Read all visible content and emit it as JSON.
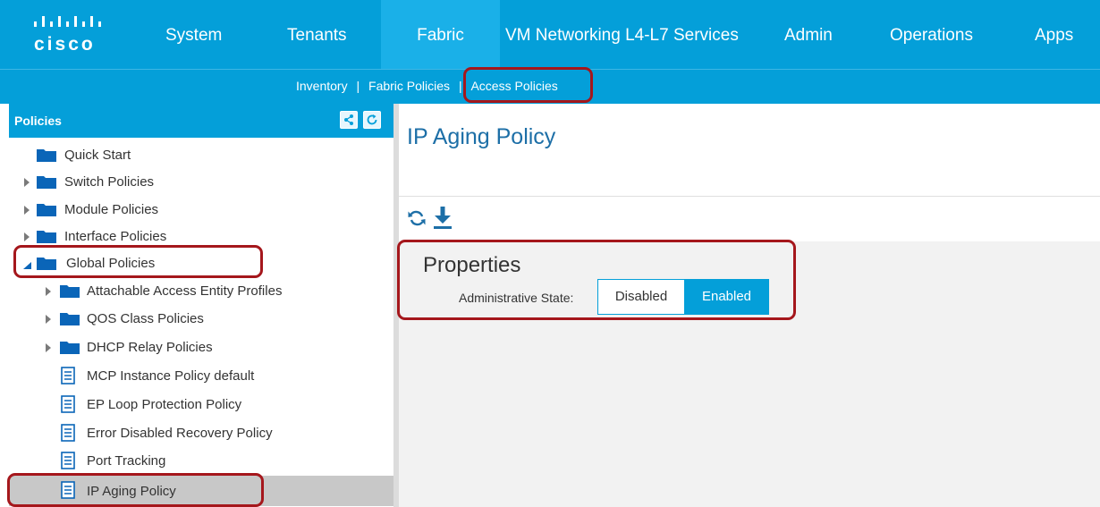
{
  "brand": {
    "logo_text": "cisco"
  },
  "topnav": {
    "items": [
      {
        "label": "System"
      },
      {
        "label": "Tenants"
      },
      {
        "label": "Fabric"
      },
      {
        "label": "VM Networking L4-L7 Services"
      },
      {
        "label": "Admin"
      },
      {
        "label": "Operations"
      },
      {
        "label": "Apps"
      }
    ],
    "active": "Fabric"
  },
  "subnav": {
    "items": [
      {
        "label": "Inventory"
      },
      {
        "label": "Fabric Policies"
      },
      {
        "label": "Access Policies"
      }
    ],
    "separator": "|",
    "active": "Access Policies"
  },
  "sidebar": {
    "title": "Policies",
    "header_icons": [
      "share-icon",
      "refresh-icon"
    ],
    "items": [
      {
        "label": "Quick Start",
        "icon": "folder-icon",
        "expandable": false
      },
      {
        "label": "Switch Policies",
        "icon": "folder-icon",
        "expandable": true,
        "expanded": false
      },
      {
        "label": "Module Policies",
        "icon": "folder-icon",
        "expandable": true,
        "expanded": false
      },
      {
        "label": "Interface Policies",
        "icon": "folder-icon",
        "expandable": true,
        "expanded": false
      },
      {
        "label": "Global Policies",
        "icon": "folder-icon",
        "expandable": true,
        "expanded": true
      },
      {
        "label": "Attachable Access Entity Profiles",
        "icon": "folder-icon",
        "expandable": true,
        "expanded": false
      },
      {
        "label": "QOS Class Policies",
        "icon": "folder-icon",
        "expandable": true,
        "expanded": false
      },
      {
        "label": "DHCP Relay Policies",
        "icon": "folder-icon",
        "expandable": true,
        "expanded": false
      },
      {
        "label": "MCP Instance Policy default",
        "icon": "policy-doc-icon",
        "expandable": false
      },
      {
        "label": "EP Loop Protection Policy",
        "icon": "policy-doc-icon",
        "expandable": false
      },
      {
        "label": "Error Disabled Recovery Policy",
        "icon": "policy-doc-icon",
        "expandable": false
      },
      {
        "label": "Port Tracking",
        "icon": "policy-doc-icon",
        "expandable": false
      },
      {
        "label": "IP Aging Policy",
        "icon": "policy-doc-icon",
        "expandable": false,
        "selected": true
      }
    ]
  },
  "main": {
    "title": "IP Aging Policy",
    "toolbar_icons": [
      "refresh-icon",
      "download-icon"
    ],
    "properties": {
      "heading": "Properties",
      "admin_state_label": "Administrative State:",
      "options": [
        "Disabled",
        "Enabled"
      ],
      "selected": "Enabled"
    }
  },
  "colors": {
    "brand_blue": "#049fd9",
    "title_blue": "#1d6fa7",
    "folder_blue": "#0a65b8",
    "callout_red": "#a5171c",
    "selected_row": "#c8c8c8"
  }
}
